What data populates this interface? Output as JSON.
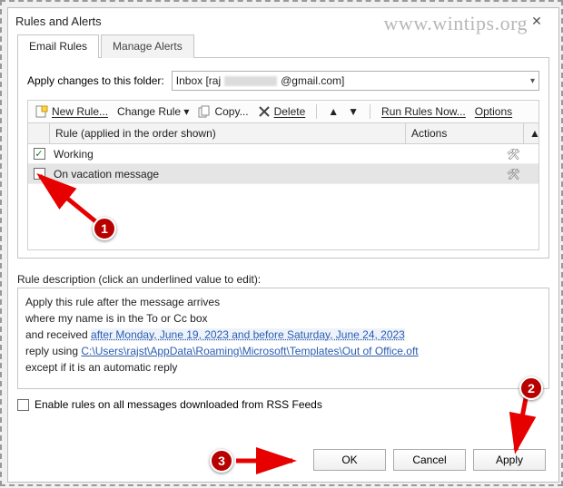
{
  "window": {
    "title": "Rules and Alerts"
  },
  "watermark": "www.wintips.org",
  "tabs": {
    "active": "Email Rules",
    "inactive": "Manage Alerts"
  },
  "folder": {
    "label": "Apply changes to this folder:",
    "prefix": "Inbox [raj",
    "suffix": "@gmail.com]"
  },
  "toolbar": {
    "new": "New Rule...",
    "change": "Change Rule",
    "copy": "Copy...",
    "delete": "Delete",
    "run": "Run Rules Now...",
    "options": "Options"
  },
  "grid": {
    "head_rule": "Rule (applied in the order shown)",
    "head_actions": "Actions",
    "rows": [
      {
        "checked": true,
        "name": "Working"
      },
      {
        "checked": false,
        "name": "On vacation message"
      }
    ]
  },
  "desc": {
    "label": "Rule description (click an underlined value to edit):",
    "l1": "Apply this rule after the message arrives",
    "l2": "where my name is in the To or Cc box",
    "l3a": "  and received ",
    "l3link": "after Monday, June 19, 2023 and before Saturday, June 24, 2023",
    "l4a": "reply using ",
    "l4link": "C:\\Users\\rajst\\AppData\\Roaming\\Microsoft\\Templates\\Out of Office.oft",
    "l5": "except if it is an automatic reply"
  },
  "rss": {
    "label": "Enable rules on all messages downloaded from RSS Feeds"
  },
  "buttons": {
    "ok": "OK",
    "cancel": "Cancel",
    "apply": "Apply"
  },
  "badges": {
    "b1": "1",
    "b2": "2",
    "b3": "3"
  }
}
